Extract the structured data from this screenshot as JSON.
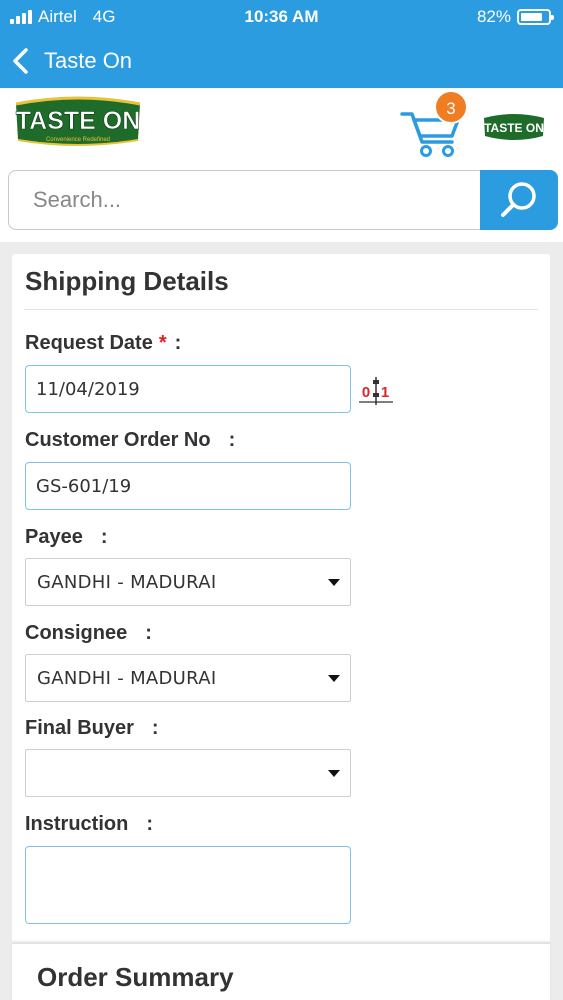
{
  "status_bar": {
    "carrier": "Airtel",
    "network": "4G",
    "time": "10:36 AM",
    "battery_percent": "82%",
    "battery_level": 0.82
  },
  "nav": {
    "title": "Taste On"
  },
  "header": {
    "cart_count": "3",
    "logo_text": "TASTE ON",
    "logo_tagline": "Convenience Redefined"
  },
  "search": {
    "placeholder": "Search..."
  },
  "shipping": {
    "title": "Shipping Details",
    "request_date": {
      "label": "Request Date",
      "required_mark": "*",
      "colon": ":",
      "value": "11/04/2019"
    },
    "customer_order_no": {
      "label": "Customer Order No",
      "colon": ":",
      "value": "GS-601/19"
    },
    "payee": {
      "label": "Payee",
      "colon": ":",
      "value": "GANDHI - MADURAI"
    },
    "consignee": {
      "label": "Consignee",
      "colon": ":",
      "value": "GANDHI - MADURAI"
    },
    "final_buyer": {
      "label": "Final Buyer",
      "colon": ":",
      "value": ""
    },
    "instruction": {
      "label": "Instruction",
      "colon": ":",
      "value": ""
    }
  },
  "order_summary": {
    "title": "Order Summary"
  },
  "colors": {
    "primary": "#2c9ce0",
    "badge": "#ef7d22",
    "logo_green": "#1e6b2a",
    "logo_gold": "#e8c23a"
  }
}
